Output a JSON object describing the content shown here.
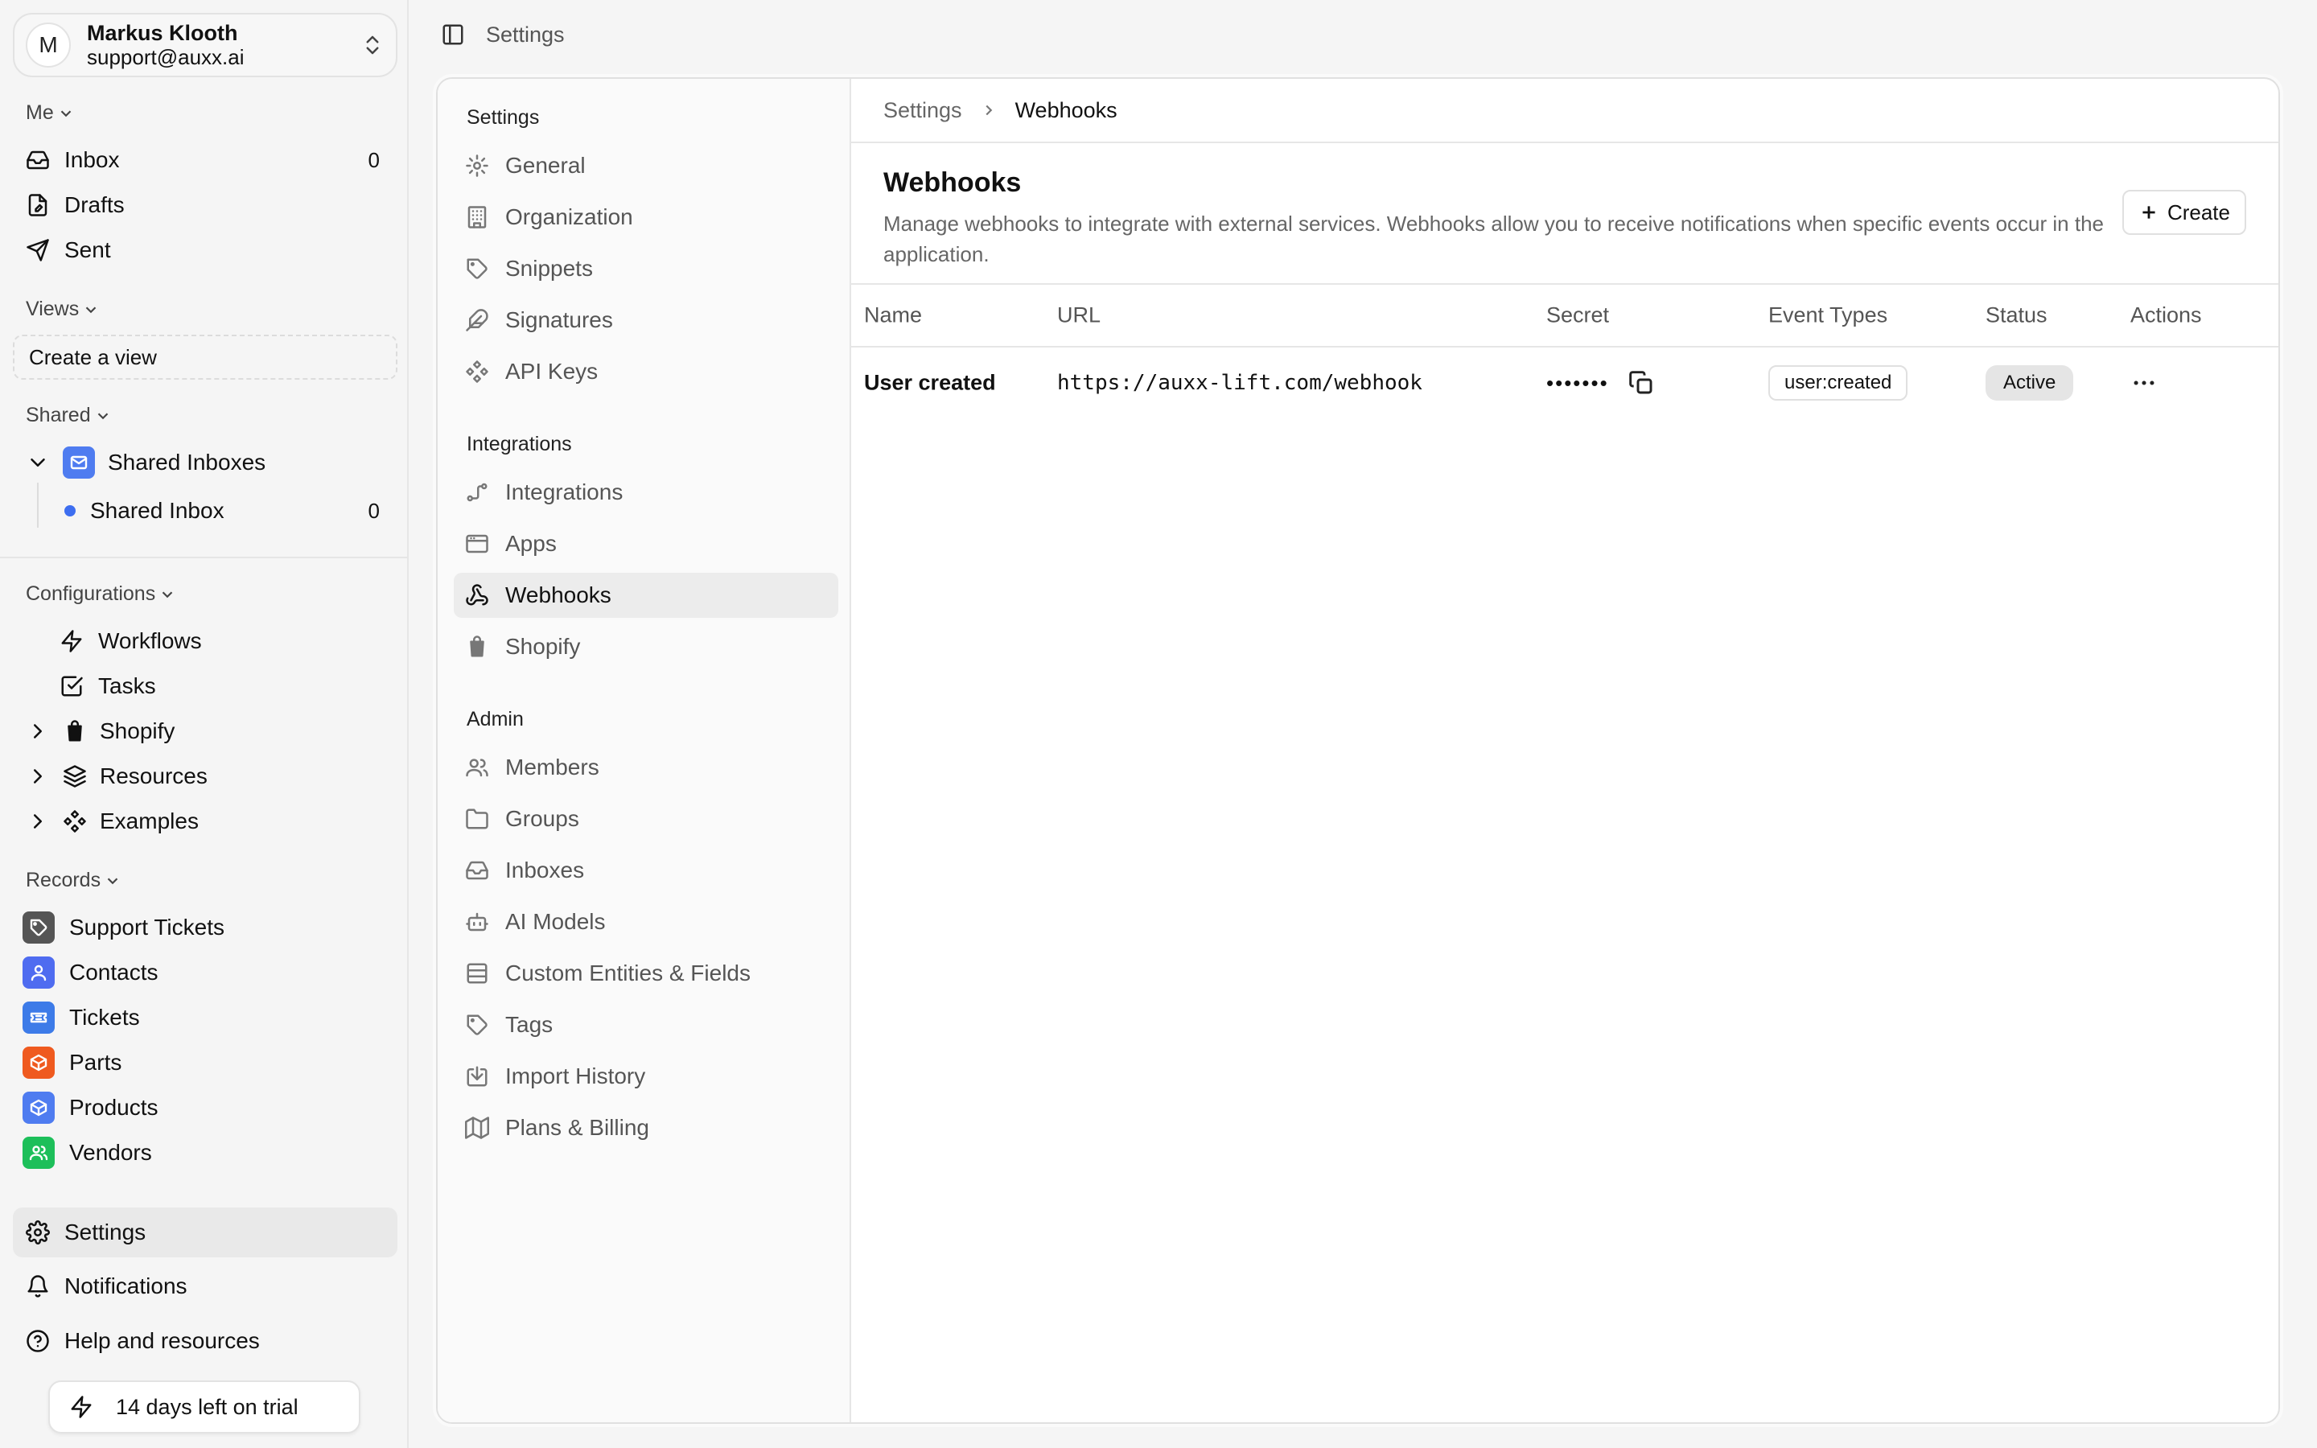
{
  "user": {
    "initial": "M",
    "name": "Markus Klooth",
    "email": "support@auxx.ai"
  },
  "sidebar": {
    "me_label": "Me",
    "me_items": [
      {
        "label": "Inbox",
        "count": "0",
        "icon": "inbox-icon"
      },
      {
        "label": "Drafts",
        "icon": "drafts-icon"
      },
      {
        "label": "Sent",
        "icon": "send-icon"
      }
    ],
    "views_label": "Views",
    "create_view": "Create a view",
    "shared_label": "Shared",
    "shared_inboxes": "Shared Inboxes",
    "shared_inbox": {
      "label": "Shared Inbox",
      "count": "0"
    },
    "configurations_label": "Configurations",
    "config_items": [
      {
        "label": "Workflows",
        "icon": "bolt-icon"
      },
      {
        "label": "Tasks",
        "icon": "checkbox-icon"
      },
      {
        "label": "Shopify",
        "icon": "shopify-icon"
      },
      {
        "label": "Resources",
        "icon": "layers-icon"
      },
      {
        "label": "Examples",
        "icon": "components-icon"
      }
    ],
    "records_label": "Records",
    "records": [
      {
        "label": "Support Tickets",
        "color": "#555555"
      },
      {
        "label": "Contacts",
        "color": "#4f6cf0"
      },
      {
        "label": "Tickets",
        "color": "#3d7be8"
      },
      {
        "label": "Parts",
        "color": "#ef5a1f"
      },
      {
        "label": "Products",
        "color": "#4f7cf0"
      },
      {
        "label": "Vendors",
        "color": "#1dbf5a"
      }
    ],
    "bottom": {
      "settings": "Settings",
      "notifications": "Notifications",
      "help": "Help and resources"
    },
    "trial": "14 days left on trial"
  },
  "topbar": {
    "title": "Settings"
  },
  "settings_nav": {
    "heading_settings": "Settings",
    "settings_items": [
      "General",
      "Organization",
      "Snippets",
      "Signatures",
      "API Keys"
    ],
    "heading_integrations": "Integrations",
    "integration_items": [
      "Integrations",
      "Apps",
      "Webhooks",
      "Shopify"
    ],
    "heading_admin": "Admin",
    "admin_items": [
      "Members",
      "Groups",
      "Inboxes",
      "AI Models",
      "Custom Entities & Fields",
      "Tags",
      "Import History",
      "Plans & Billing"
    ],
    "active": "Webhooks"
  },
  "content": {
    "breadcrumb": [
      "Settings",
      "Webhooks"
    ],
    "title": "Webhooks",
    "description": "Manage webhooks to integrate with external services. Webhooks allow you to receive notifications when specific events occur in the application.",
    "create_label": "Create",
    "table": {
      "headers": [
        "Name",
        "URL",
        "Secret",
        "Event Types",
        "Status",
        "Actions"
      ],
      "rows": [
        {
          "name": "User created",
          "url": "https://auxx-lift.com/webhook",
          "secret": "•••••••",
          "event": "user:created",
          "status": "Active"
        }
      ]
    }
  }
}
